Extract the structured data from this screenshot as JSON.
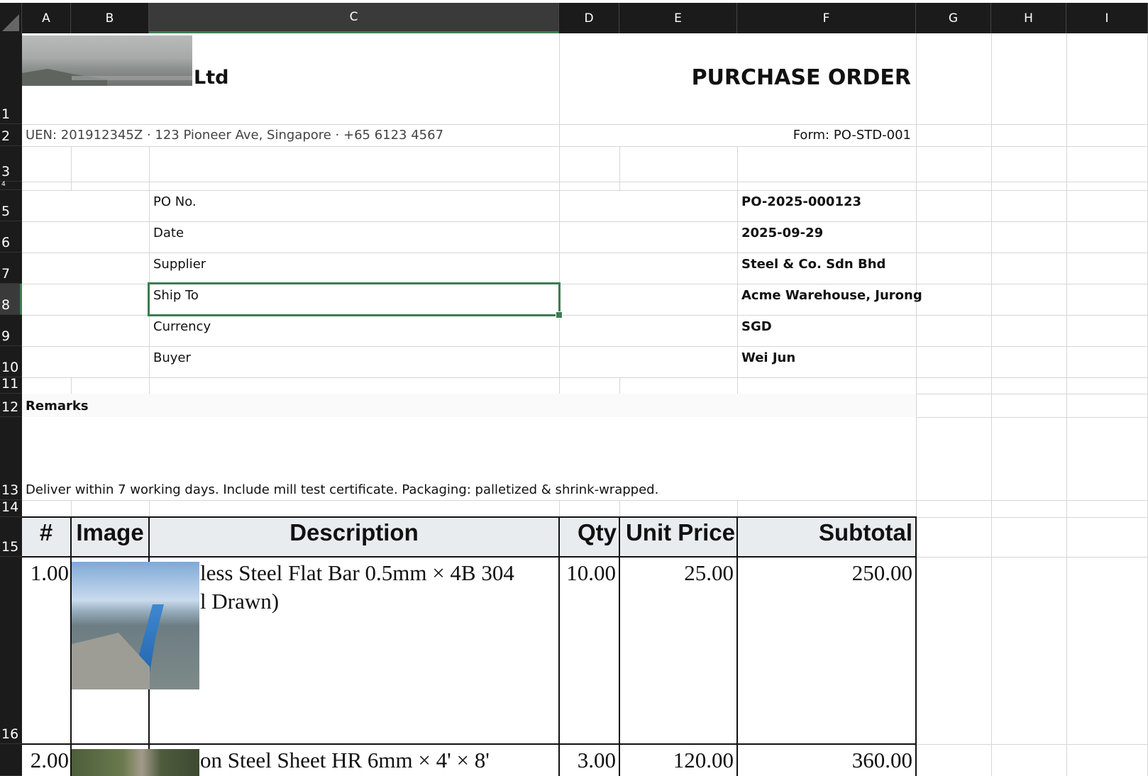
{
  "columns": [
    "A",
    "B",
    "C",
    "D",
    "E",
    "F",
    "G",
    "H",
    "I"
  ],
  "rows": [
    "1",
    "2",
    "3",
    "4",
    "5",
    "6",
    "7",
    "8",
    "9",
    "10",
    "11",
    "12",
    "13",
    "14",
    "15",
    "16"
  ],
  "header": {
    "company_suffix": "Ltd",
    "title": "PURCHASE ORDER",
    "company_info": "UEN: 201912345Z · 123 Pioneer Ave, Singapore · +65 6123 4567",
    "form_no": "Form: PO-STD-001"
  },
  "po_details": [
    {
      "label": "PO No.",
      "value": "PO-2025-000123"
    },
    {
      "label": "Date",
      "value": "2025-09-29"
    },
    {
      "label": "Supplier",
      "value": "Steel & Co. Sdn Bhd"
    },
    {
      "label": "Ship To",
      "value": "Acme Warehouse, Jurong"
    },
    {
      "label": "Currency",
      "value": "SGD"
    },
    {
      "label": "Buyer",
      "value": "Wei Jun"
    }
  ],
  "remarks": {
    "label": "Remarks",
    "text": "Deliver within 7 working days. Include mill test certificate. Packaging: palletized & shrink-wrapped."
  },
  "table": {
    "headers": [
      "#",
      "Image",
      "Description",
      "Qty",
      "Unit Price",
      "Subtotal"
    ],
    "rows": [
      {
        "no": "1.00",
        "desc_line1": "less Steel Flat Bar 0.5mm × 4B 304",
        "desc_line2": "l Drawn)",
        "qty": "10.00",
        "unit_price": "25.00",
        "subtotal": "250.00"
      },
      {
        "no": "2.00",
        "desc_line1": "on Steel Sheet HR 6mm × 4' × 8'",
        "qty": "3.00",
        "unit_price": "120.00",
        "subtotal": "360.00"
      }
    ]
  },
  "colors": {
    "selection": "#3b7d4f",
    "header_fill": "#e9ecef",
    "chrome": "#1b1b1b"
  }
}
